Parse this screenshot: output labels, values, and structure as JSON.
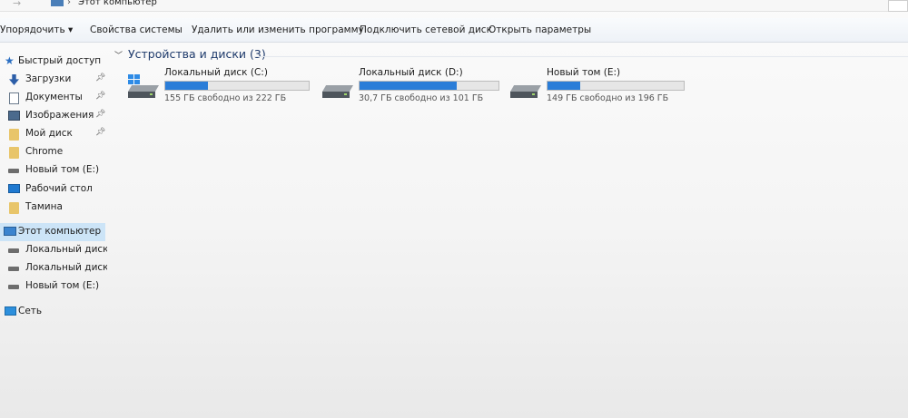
{
  "address": {
    "location": "Этот компьютер"
  },
  "toolbar": {
    "organize": "Упорядочить ▾",
    "system_props": "Свойства системы",
    "uninstall": "Удалить или изменить программу",
    "map_drive": "Подключить сетевой диск",
    "open_settings": "Открыть параметры"
  },
  "nav": {
    "quick_access": "Быстрый доступ",
    "downloads": "Загрузки",
    "documents": "Документы",
    "pictures": "Изображения",
    "my_drive": "Мой диск",
    "chrome": "Chrome",
    "new_volume": "Новый том (E:)",
    "desktop": "Рабочий стол",
    "tamina": "Тамина",
    "this_pc": "Этот компьютер",
    "local_c": "Локальный диск (C",
    "local_d": "Локальный диск (D",
    "new_volume_e": "Новый том (E:)",
    "network": "Сеть"
  },
  "group": {
    "title": "Устройства и диски (3)"
  },
  "drives": [
    {
      "name": "Локальный диск (C:)",
      "free_text": "155 ГБ свободно из 222 ГБ",
      "used_fraction": 0.3
    },
    {
      "name": "Локальный диск (D:)",
      "free_text": "30,7 ГБ свободно из 101 ГБ",
      "used_fraction": 0.7
    },
    {
      "name": "Новый том (E:)",
      "free_text": "149 ГБ свободно из 196 ГБ",
      "used_fraction": 0.24
    }
  ],
  "colors": {
    "accent": "#2a7dd8",
    "selection": "#cce4f7"
  }
}
